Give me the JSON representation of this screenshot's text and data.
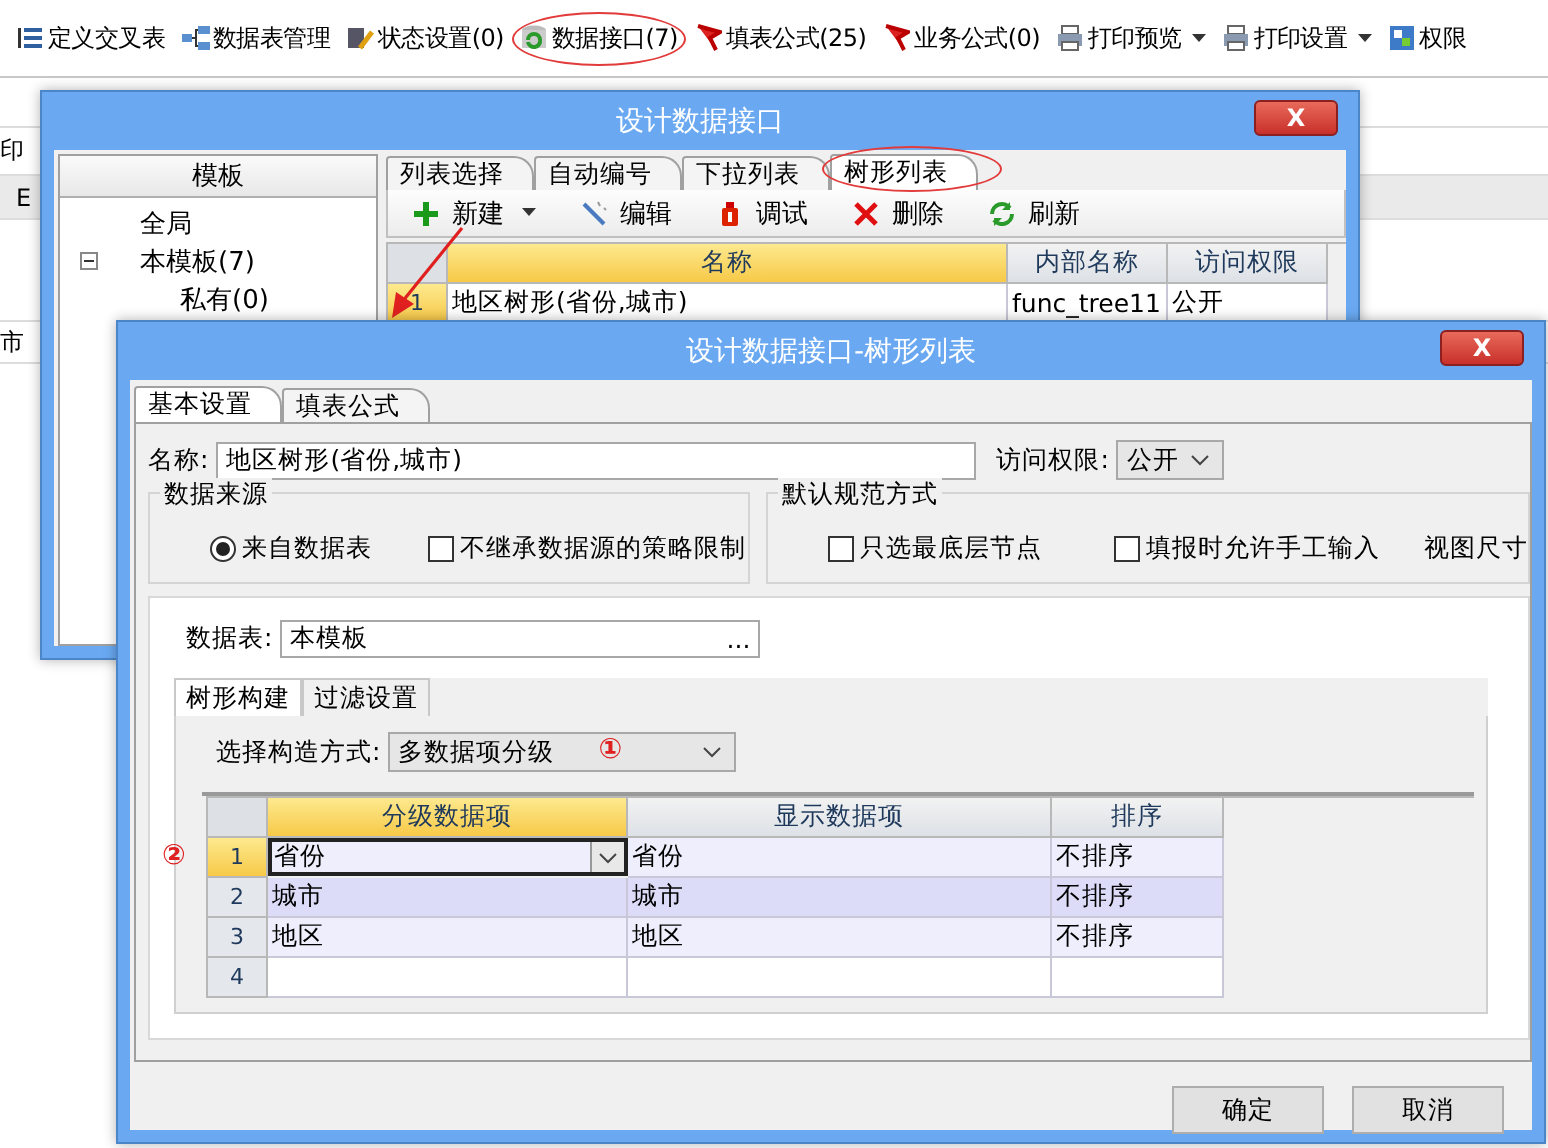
{
  "toolbar": [
    {
      "label": "定义交叉表",
      "kind": "columns",
      "dropdown": false,
      "highlighted": false
    },
    {
      "label": "数据表管理",
      "kind": "tables",
      "dropdown": false,
      "highlighted": false
    },
    {
      "label": "状态设置(0)",
      "kind": "status",
      "dropdown": false,
      "highlighted": false
    },
    {
      "label": "数据接口(7)",
      "kind": "database",
      "dropdown": false,
      "highlighted": true
    },
    {
      "label": "填表公式(25)",
      "kind": "flag",
      "dropdown": false,
      "highlighted": false
    },
    {
      "label": "业务公式(0)",
      "kind": "flag",
      "dropdown": false,
      "highlighted": false
    },
    {
      "label": "打印预览",
      "kind": "printer",
      "dropdown": true,
      "highlighted": false
    },
    {
      "label": "打印设置",
      "kind": "printer",
      "dropdown": true,
      "highlighted": false
    },
    {
      "label": "权限",
      "kind": "permission",
      "dropdown": false,
      "highlighted": false
    }
  ],
  "background": {
    "fragments": [
      "印",
      "E",
      "市"
    ]
  },
  "dialog1": {
    "title": "设计数据接口",
    "close": "X",
    "sidebar": {
      "header": "模板",
      "tree": [
        {
          "label": "全局"
        },
        {
          "label": "本模板(7)",
          "expanded": true,
          "children": [
            {
              "label": "私有(0)"
            }
          ]
        }
      ]
    },
    "tabs": [
      {
        "label": "列表选择",
        "selected": false,
        "highlighted": false
      },
      {
        "label": "自动编号",
        "selected": false,
        "highlighted": false
      },
      {
        "label": "下拉列表",
        "selected": false,
        "highlighted": false
      },
      {
        "label": "树形列表",
        "selected": true,
        "highlighted": true
      }
    ],
    "actions": [
      {
        "label": "新建",
        "kind": "add",
        "dropdown": true
      },
      {
        "label": "编辑",
        "kind": "edit",
        "dropdown": false
      },
      {
        "label": "调试",
        "kind": "debug",
        "dropdown": false
      },
      {
        "label": "删除",
        "kind": "delete",
        "dropdown": false
      },
      {
        "label": "刷新",
        "kind": "refresh",
        "dropdown": false
      }
    ],
    "grid": {
      "columns": [
        {
          "label": "名称",
          "selected": true
        },
        {
          "label": "内部名称",
          "selected": false
        },
        {
          "label": "访问权限",
          "selected": false
        }
      ],
      "rows": [
        {
          "number": "1",
          "current": true,
          "cells": [
            "地区树形(省份,城市)",
            "func_tree11",
            "公开"
          ]
        }
      ]
    }
  },
  "dialog2": {
    "title": "设计数据接口-树形列表",
    "close": "X",
    "tabs": [
      {
        "label": "基本设置",
        "selected": true
      },
      {
        "label": "填表公式",
        "selected": false
      }
    ],
    "name_label": "名称:",
    "name_value": "地区树形(省份,城市)",
    "access_label": "访问权限:",
    "access_value": "公开",
    "data_source": {
      "title": "数据来源",
      "radio": {
        "label": "来自数据表",
        "selected": true
      },
      "checkbox": {
        "label": "不继承数据源的策略限制",
        "checked": false
      }
    },
    "default_spec": {
      "title": "默认规范方式",
      "checkboxes": [
        {
          "label": "只选最底层节点",
          "checked": false
        },
        {
          "label": "填报时允许手工输入",
          "checked": false
        }
      ],
      "extra": "视图尺寸"
    },
    "table_label": "数据表:",
    "table_value": "本模板",
    "browse": "...",
    "inner_tabs": [
      {
        "label": "树形构建",
        "selected": true
      },
      {
        "label": "过滤设置",
        "selected": false
      }
    ],
    "method_label": "选择构造方式:",
    "method_value": "多数据项分级",
    "marker_1": "①",
    "marker_2": "②",
    "grid": {
      "columns": [
        {
          "label": "分级数据项",
          "selected": true
        },
        {
          "label": "显示数据项",
          "selected": false
        },
        {
          "label": "排序",
          "selected": false
        }
      ],
      "rows": [
        {
          "number": "1",
          "current": true,
          "cells": [
            "省份",
            "省份",
            "不排序"
          ]
        },
        {
          "number": "2",
          "current": false,
          "cells": [
            "城市",
            "城市",
            "不排序"
          ]
        },
        {
          "number": "3",
          "current": false,
          "cells": [
            "地区",
            "地区",
            "不排序"
          ]
        },
        {
          "number": "4",
          "current": false
        }
      ]
    },
    "buttons": [
      "确定",
      "取消"
    ]
  }
}
